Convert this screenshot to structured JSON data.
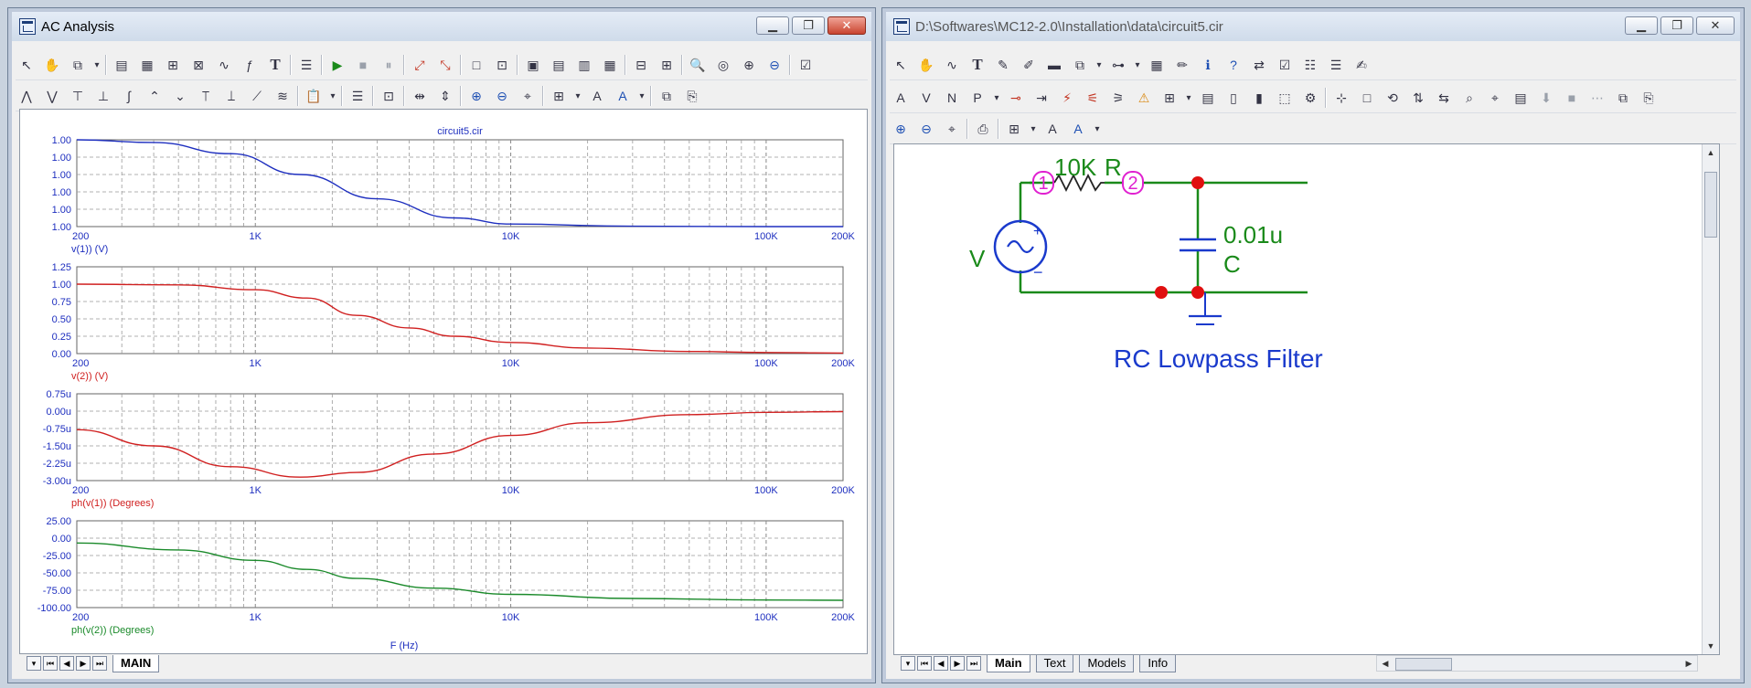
{
  "left_window": {
    "title": "AC Analysis",
    "toolbar1": [
      "select-arrow-icon",
      "hand-pan-icon",
      "copy-graph-icon",
      "dropdown-icon",
      "sep",
      "graph-icon",
      "plot-graph-icon",
      "graph-zoom-icon",
      "graph-scale-icon",
      "graph-curve-icon",
      "graph-function-icon",
      "text-T-icon",
      "sep",
      "properties-icon",
      "sep",
      "run-icon",
      "stop-icon",
      "pause-icon",
      "sep",
      "scale-icon",
      "scale-fit-icon",
      "sep",
      "layout-single-icon",
      "layout-grid-icon",
      "sep",
      "tile-icon",
      "tile-2-icon",
      "tile-3-icon",
      "tile-4-icon",
      "sep",
      "split-h-icon",
      "split-v-icon",
      "sep",
      "zoom-search-icon",
      "zoom-target-icon",
      "zoom-find-icon",
      "zoom-out-icon",
      "sep",
      "options-icon"
    ],
    "toolbar2": [
      "cursor-peak-icon",
      "cursor-valley-icon",
      "cursor-high-icon",
      "cursor-low-icon",
      "cursor-inflection-icon",
      "cursor-global-high-icon",
      "cursor-global-low-icon",
      "cursor-top-icon",
      "cursor-bottom-icon",
      "cursor-slope-icon",
      "cursor-next-icon",
      "sep",
      "paste-icon",
      "dropdown-icon",
      "sep",
      "list-icon",
      "sep",
      "label-icon",
      "sep",
      "mark-h-icon",
      "mark-v-icon",
      "sep",
      "zoom-in-icon",
      "zoom-out-icon",
      "zoom-pan-icon",
      "sep",
      "grid-icon",
      "dropdown-icon",
      "font-A-icon",
      "font-color-icon",
      "dropdown-icon",
      "sep",
      "copy-icon",
      "paste-plot-icon"
    ],
    "bottom_tab": "MAIN",
    "xlabel": "F (Hz)"
  },
  "right_window": {
    "title": "D:\\Softwares\\MC12-2.0\\Installation\\data\\circuit5.cir",
    "toolbar1": [
      "select-arrow-icon",
      "hand-pan-icon",
      "wire-icon",
      "text-T-icon",
      "pen-icon",
      "pen-2-icon",
      "bus-icon",
      "copy-icon",
      "dropdown-icon",
      "component-icon",
      "dropdown-icon",
      "grid-table-icon",
      "pencil-icon",
      "info-icon",
      "help-icon",
      "flow-icon",
      "checkbox-icon",
      "check-list-icon",
      "list-icon",
      "edit-icon"
    ],
    "toolbar2": [
      "attr-text-icon",
      "attr-value-icon",
      "attr-node-icon",
      "attr-pin-icon",
      "dropdown-icon",
      "probe-icon",
      "arrow-icon",
      "probe-2-icon",
      "probe-3-icon",
      "probe-4-icon",
      "warning-icon",
      "grid-icon",
      "dropdown-icon",
      "doc-icon",
      "page-icon",
      "page-2-icon",
      "select-box-icon",
      "props-icon",
      "sep",
      "node-icon",
      "box-icon",
      "rotate-icon",
      "flip-icon",
      "mirror-icon",
      "find-icon",
      "find-2-icon",
      "page-3-icon",
      "down-icon",
      "stop-icon",
      "more-icon",
      "copy-2-icon",
      "paste-2-icon"
    ],
    "toolbar3": [
      "zoom-in-icon",
      "zoom-out-icon",
      "zoom-pan-icon",
      "sep",
      "print-icon",
      "sep",
      "grid-icon",
      "dropdown-icon",
      "font-A-icon",
      "font-color-icon",
      "dropdown-icon"
    ],
    "tabs": [
      "Main",
      "Text",
      "Models",
      "Info"
    ],
    "schematic": {
      "resistor_value": "10K",
      "resistor_name": "R",
      "cap_value": "0.01u",
      "cap_name": "C",
      "source_name": "V",
      "node1": "1",
      "node2": "2",
      "plus": "+",
      "minus": "−",
      "caption": "RC Lowpass Filter"
    }
  },
  "chart_data": [
    {
      "type": "line",
      "title": "circuit5.cir",
      "xscale": "log",
      "xlim": [
        200,
        200000
      ],
      "xticks": [
        "200",
        "1K",
        "10K",
        "100K",
        "200K"
      ],
      "yticks": [
        "1.00",
        "1.00",
        "1.00",
        "1.00",
        "1.00",
        "1.00"
      ],
      "ylim": [
        0,
        5
      ],
      "ylabel": "v(1)) (V)",
      "color": "#1e2fbf",
      "x": [
        200,
        400,
        800,
        1500,
        3000,
        6000,
        10000,
        30000,
        100000,
        200000
      ],
      "y": [
        5,
        4.85,
        4.2,
        3.0,
        1.6,
        0.5,
        0.15,
        0.02,
        0,
        0
      ]
    },
    {
      "type": "line",
      "xscale": "log",
      "xlim": [
        200,
        200000
      ],
      "xticks": [
        "200",
        "1K",
        "10K",
        "100K",
        "200K"
      ],
      "yticks": [
        "1.25",
        "1.00",
        "0.75",
        "0.50",
        "0.25",
        "0.00"
      ],
      "ylim": [
        0,
        1.25
      ],
      "ylabel": "v(2)) (V)",
      "color": "#d02020",
      "x": [
        200,
        500,
        1000,
        1591,
        2500,
        4000,
        6000,
        10000,
        20000,
        50000,
        100000,
        200000
      ],
      "y": [
        1.0,
        0.99,
        0.92,
        0.8,
        0.55,
        0.37,
        0.25,
        0.16,
        0.08,
        0.03,
        0.016,
        0.008
      ]
    },
    {
      "type": "line",
      "xscale": "log",
      "xlim": [
        200,
        200000
      ],
      "xticks": [
        "200",
        "1K",
        "10K",
        "100K",
        "200K"
      ],
      "yticks": [
        "0.75u",
        "0.00u",
        "-0.75u",
        "-1.50u",
        "-2.25u",
        "-3.00u"
      ],
      "ylim": [
        -3.0,
        0.75
      ],
      "ylabel": "ph(v(1)) (Degrees)",
      "color": "#d02020",
      "x": [
        200,
        400,
        800,
        1500,
        2500,
        5000,
        10000,
        20000,
        50000,
        100000,
        200000
      ],
      "y": [
        -0.8,
        -1.5,
        -2.4,
        -2.85,
        -2.65,
        -1.85,
        -1.05,
        -0.5,
        -0.15,
        -0.05,
        -0.02
      ]
    },
    {
      "type": "line",
      "xscale": "log",
      "xlim": [
        200,
        200000
      ],
      "xticks": [
        "200",
        "1K",
        "10K",
        "100K",
        "200K"
      ],
      "yticks": [
        "25.00",
        "0.00",
        "-25.00",
        "-50.00",
        "-75.00",
        "-100.00"
      ],
      "ylim": [
        -100,
        25
      ],
      "ylabel": "ph(v(2)) (Degrees)",
      "color": "#1a8a2a",
      "x": [
        200,
        500,
        1000,
        1591,
        2500,
        5000,
        10000,
        30000,
        100000,
        200000
      ],
      "y": [
        -7,
        -17,
        -32,
        -45,
        -58,
        -72,
        -80.9,
        -86.9,
        -89.1,
        -89.5
      ]
    }
  ]
}
